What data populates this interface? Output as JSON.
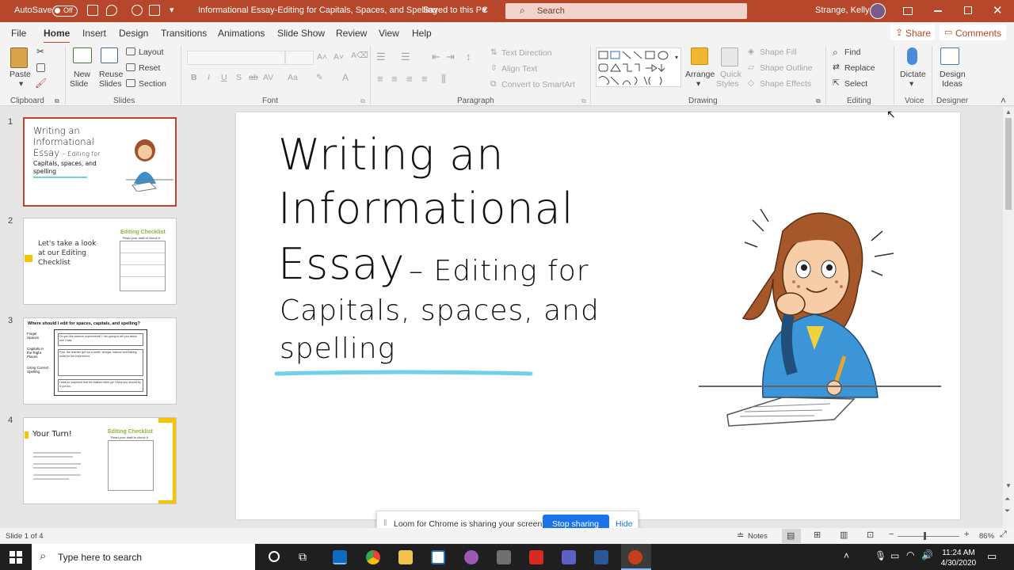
{
  "titlebar": {
    "autosave_label": "AutoSave",
    "autosave_state": "Off",
    "doc_title": "Informational Essay-Editing for Capitals, Spaces, and Spelling",
    "saved_status": "Saved to this PC",
    "search_placeholder": "Search",
    "user_name": "Strange, Kelly"
  },
  "menu": {
    "tabs": [
      "File",
      "Home",
      "Insert",
      "Design",
      "Transitions",
      "Animations",
      "Slide Show",
      "Review",
      "View",
      "Help"
    ],
    "share": "Share",
    "comments": "Comments"
  },
  "ribbon": {
    "clipboard": {
      "paste": "Paste",
      "group": "Clipboard"
    },
    "slides": {
      "new_slide_1": "New",
      "new_slide_2": "Slide",
      "reuse_1": "Reuse",
      "reuse_2": "Slides",
      "layout": "Layout",
      "reset": "Reset",
      "section": "Section",
      "group": "Slides"
    },
    "font": {
      "group": "Font",
      "bold": "B",
      "italic": "I",
      "underline": "U",
      "strike": "S",
      "spacing": "AV",
      "case": "Aa",
      "color": "A"
    },
    "paragraph": {
      "text_direction": "Text Direction",
      "align_text": "Align Text",
      "smartart": "Convert to SmartArt",
      "group": "Paragraph"
    },
    "drawing": {
      "arrange": "Arrange",
      "quick_1": "Quick",
      "quick_2": "Styles",
      "shape_fill": "Shape Fill",
      "shape_outline": "Shape Outline",
      "shape_effects": "Shape Effects",
      "group": "Drawing"
    },
    "editing": {
      "find": "Find",
      "replace": "Replace",
      "select": "Select",
      "group": "Editing"
    },
    "voice": {
      "dictate": "Dictate",
      "group": "Voice"
    },
    "designer": {
      "ideas_1": "Design",
      "ideas_2": "Ideas",
      "group": "Designer"
    }
  },
  "thumbnails": [
    {
      "num": "1",
      "line1": "Writing an",
      "line2": "Informational",
      "line3": "Essay",
      "line3b": "– Editing for",
      "line4": "Capitals, spaces, and",
      "line5": "spelling"
    },
    {
      "num": "2",
      "text1": "Let's take a look",
      "text2": "at our Editing",
      "text3": "Checklist",
      "heading": "Editing Checklist",
      "sub": "Read your draft to check it"
    },
    {
      "num": "3",
      "heading": "Where should I edit for spaces, capitals, and spelling?",
      "l1": "Finger Spaces",
      "l2": "Capitals in the Right Places",
      "l3": "Using Correct Spelling",
      "box1": "Do you like science experiments? I am going to tell you about one I saw.",
      "box2": "First, the teacher got out a bottle, vinegar, balloon and baking soda for the experiment.",
      "box3": "I was so surprised that the balloon blew up! I think you should try it out too."
    },
    {
      "num": "4",
      "heading": "Your Turn!",
      "checklist": "Editing Checklist",
      "sub": "Read your draft to check it"
    }
  ],
  "slide": {
    "line1": "Writing an",
    "line2": "Informational",
    "line3a": "Essay",
    "line3b": "– Editing for",
    "line4": "Capitals, spaces, and",
    "line5": "spelling"
  },
  "loom": {
    "message": "Loom for Chrome is sharing your screen.",
    "stop": "Stop sharing",
    "hide": "Hide"
  },
  "status": {
    "slide_info": "Slide 1 of 4",
    "notes": "Notes",
    "zoom": "86%"
  },
  "taskbar": {
    "search_placeholder": "Type here to search",
    "time": "11:24 AM",
    "date": "4/30/2020"
  },
  "colors": {
    "accent": "#b7472a",
    "underline": "#6ed0ea",
    "loom_button": "#1a73e8"
  }
}
